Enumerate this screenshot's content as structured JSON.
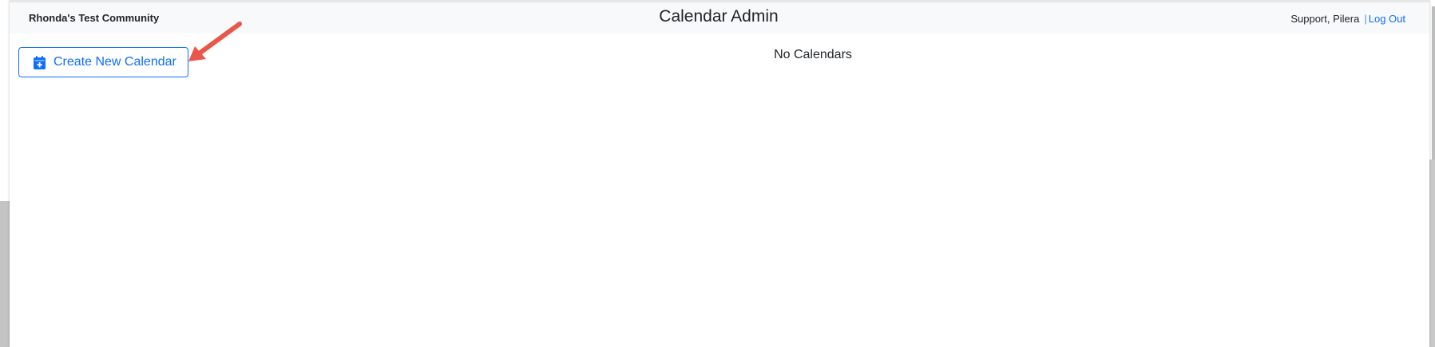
{
  "navbar": {
    "community_name": "Rhonda's Test Community",
    "title": "Calendar Admin",
    "user_name": "Support, Pilera",
    "separator": "|",
    "logout_label": "Log Out"
  },
  "main": {
    "create_button_label": "Create New Calendar",
    "create_button_icon": "calendar-plus-icon",
    "empty_message": "No Calendars"
  },
  "annotation": {
    "icon": "red-arrow-icon",
    "color": "#e8574a"
  },
  "colors": {
    "accent": "#0d6efd",
    "navbar_bg": "#f8f9fa",
    "text": "#212529"
  }
}
